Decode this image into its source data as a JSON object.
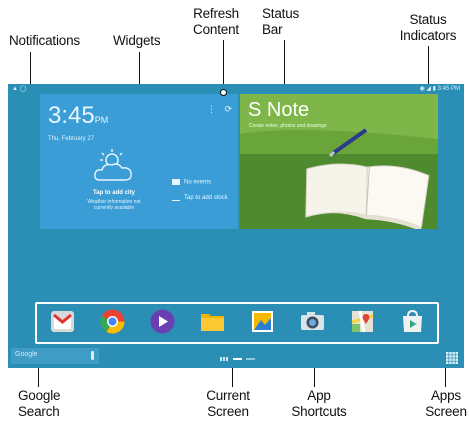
{
  "callouts": {
    "notifications": "Notifications",
    "widgets": "Widgets",
    "refresh_line1": "Refresh",
    "refresh_line2": "Content",
    "status_line1": "Status",
    "status_line2": "Bar",
    "indicators_line1": "Status",
    "indicators_line2": "Indicators",
    "google_line1": "Google",
    "google_line2": "Search",
    "current_line1": "Current",
    "current_line2": "Screen",
    "shortcuts_line1": "App",
    "shortcuts_line2": "Shortcuts",
    "apps_line1": "Apps",
    "apps_line2": "Screen"
  },
  "status_bar": {
    "time": "3:45 PM"
  },
  "widget": {
    "clock": "3:45",
    "ampm": "PM",
    "date": "Thu, February 27",
    "tap_city": "Tap to add city",
    "weather_note_1": "Weather information not",
    "weather_note_2": "currently available",
    "no_events": "No events",
    "add_stock": "Tap to add stock"
  },
  "snote": {
    "title": "S Note",
    "subtitle": "Create notes, photos and drawings"
  },
  "search": {
    "label": "Google"
  },
  "dock": {
    "apps": [
      "gmail-icon",
      "chrome-icon",
      "play-movies-icon",
      "my-files-icon",
      "gallery-icon",
      "camera-icon",
      "maps-icon",
      "play-store-icon"
    ]
  },
  "colors": {
    "screen_bg": "#2b8fb5",
    "widget_bg": "#3b9dd6",
    "callout_text": "#111111"
  }
}
